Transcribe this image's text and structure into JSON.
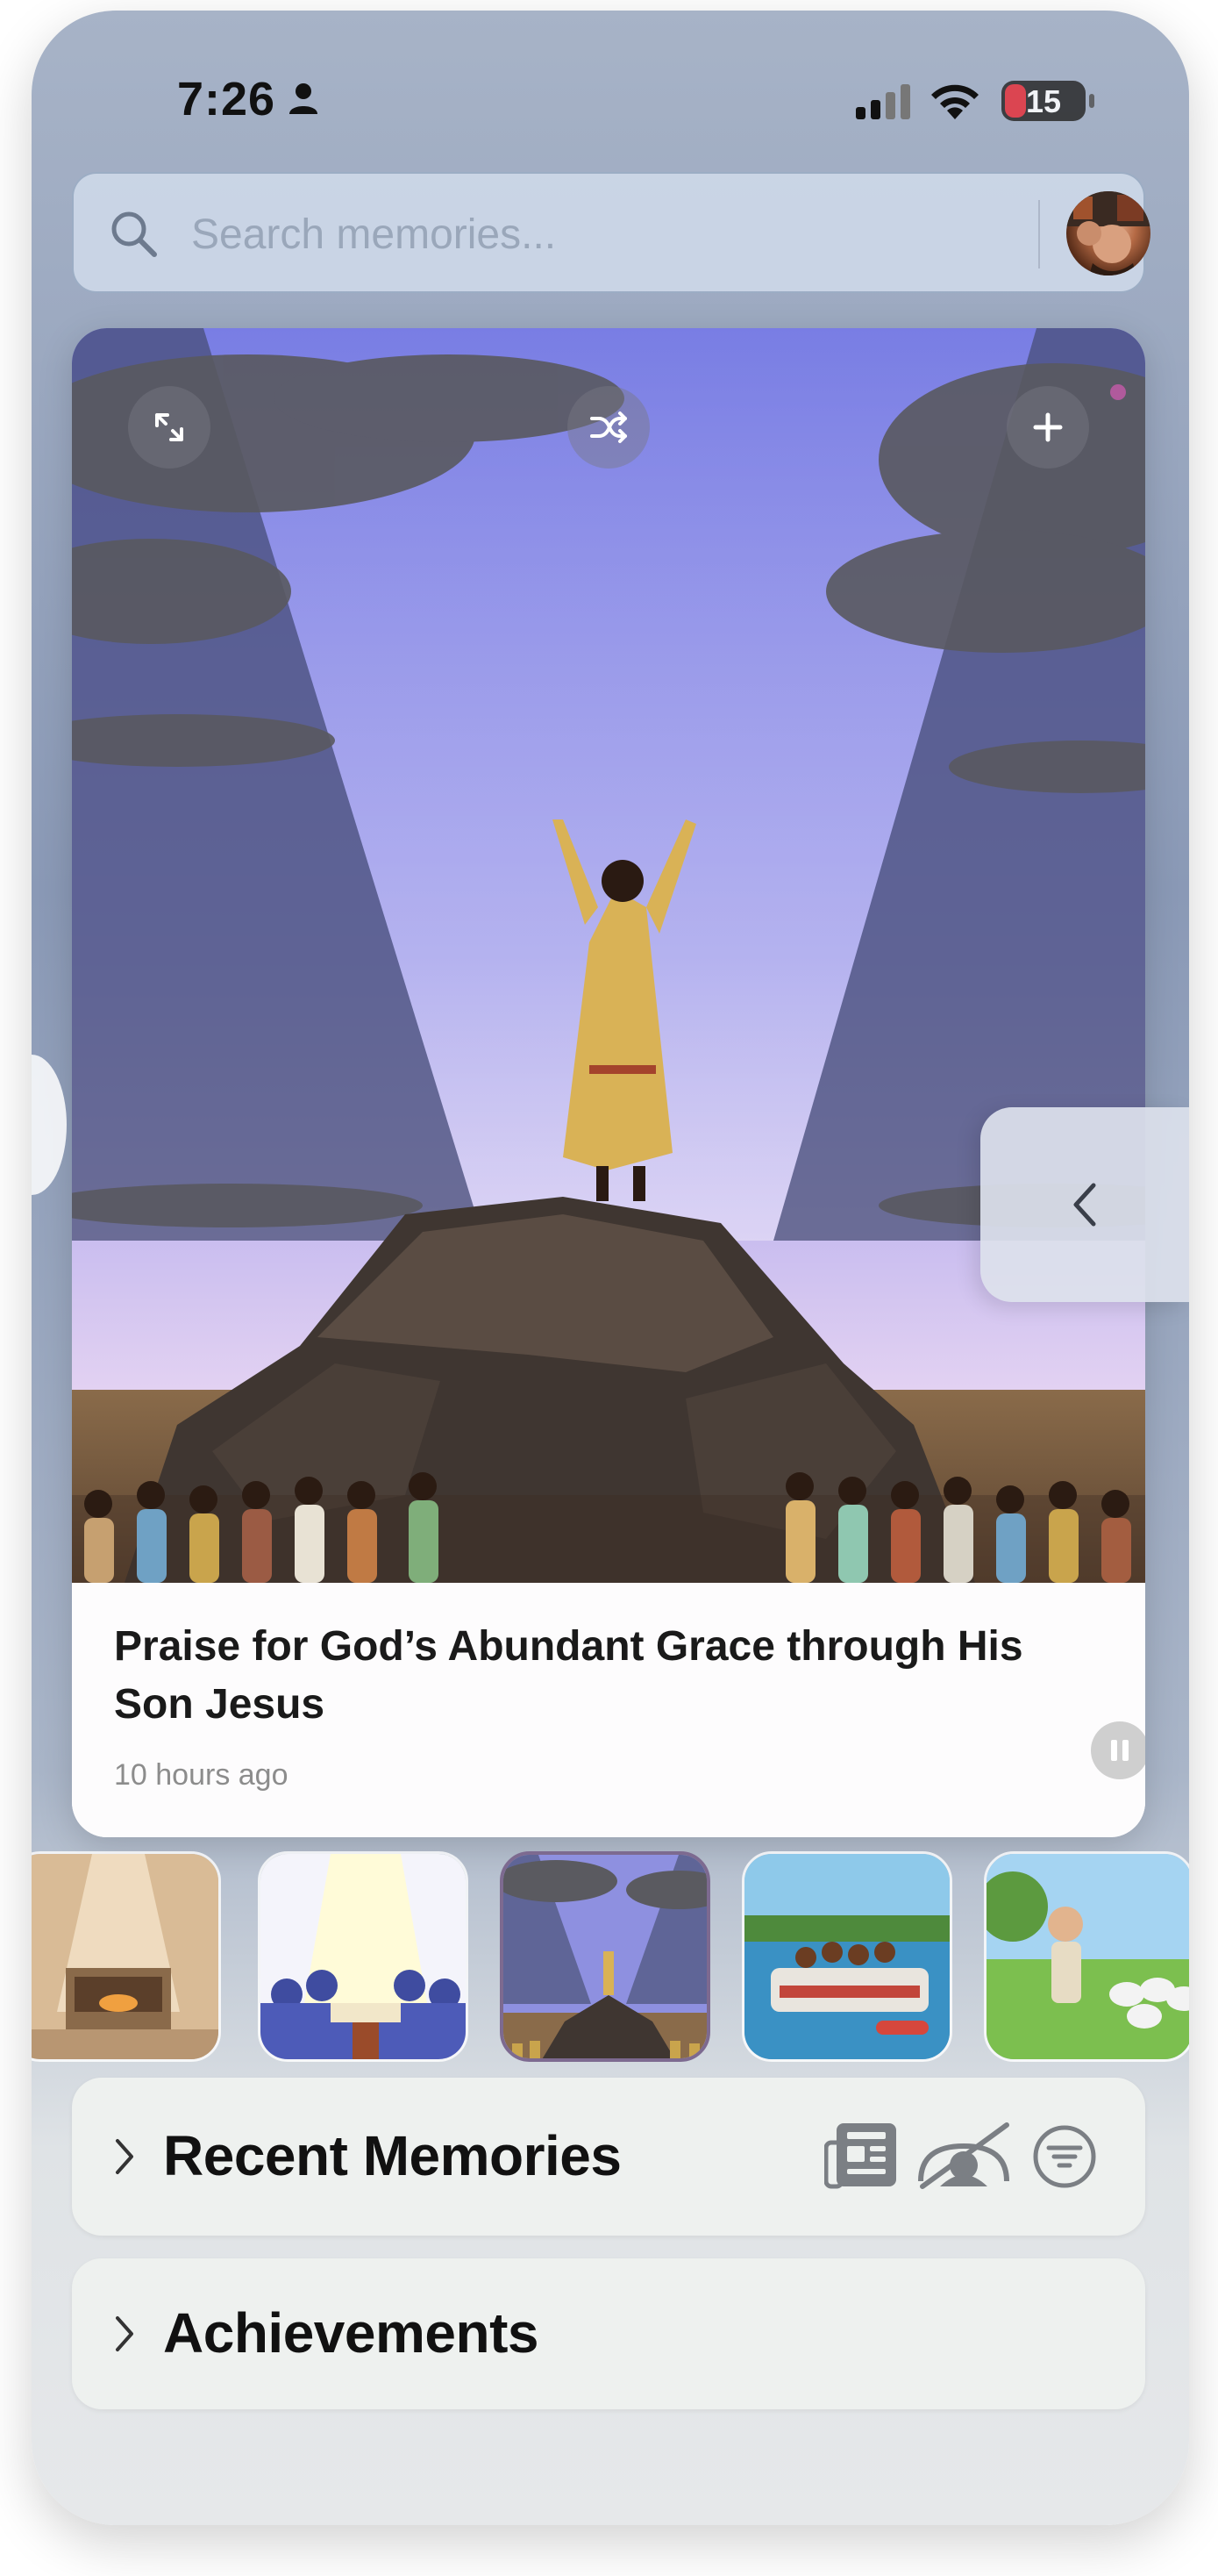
{
  "status_bar": {
    "time": "7:26",
    "battery": "15"
  },
  "search": {
    "placeholder": "Search memories..."
  },
  "featured": {
    "title": "Praise for God’s Abundant Grace through His Son Jesus",
    "timestamp": "10 hours ago",
    "controls": [
      "expand-icon",
      "shuffle-icon",
      "plus-icon",
      "pause-icon"
    ]
  },
  "thumbnails": [
    {
      "name": "altar-fire"
    },
    {
      "name": "open-book-light"
    },
    {
      "name": "praise-on-rock",
      "selected": true
    },
    {
      "name": "pontoon-boat"
    },
    {
      "name": "shepherd-boy"
    }
  ],
  "sections": {
    "recent_memories": {
      "label": "Recent Memories",
      "icons": [
        "newspaper-icon",
        "hidden-eye-icon",
        "filter-icon"
      ]
    },
    "achievements": {
      "label": "Achievements"
    }
  },
  "colors": {
    "accent": "#7d6a90",
    "battery_low": "#e5333d"
  }
}
